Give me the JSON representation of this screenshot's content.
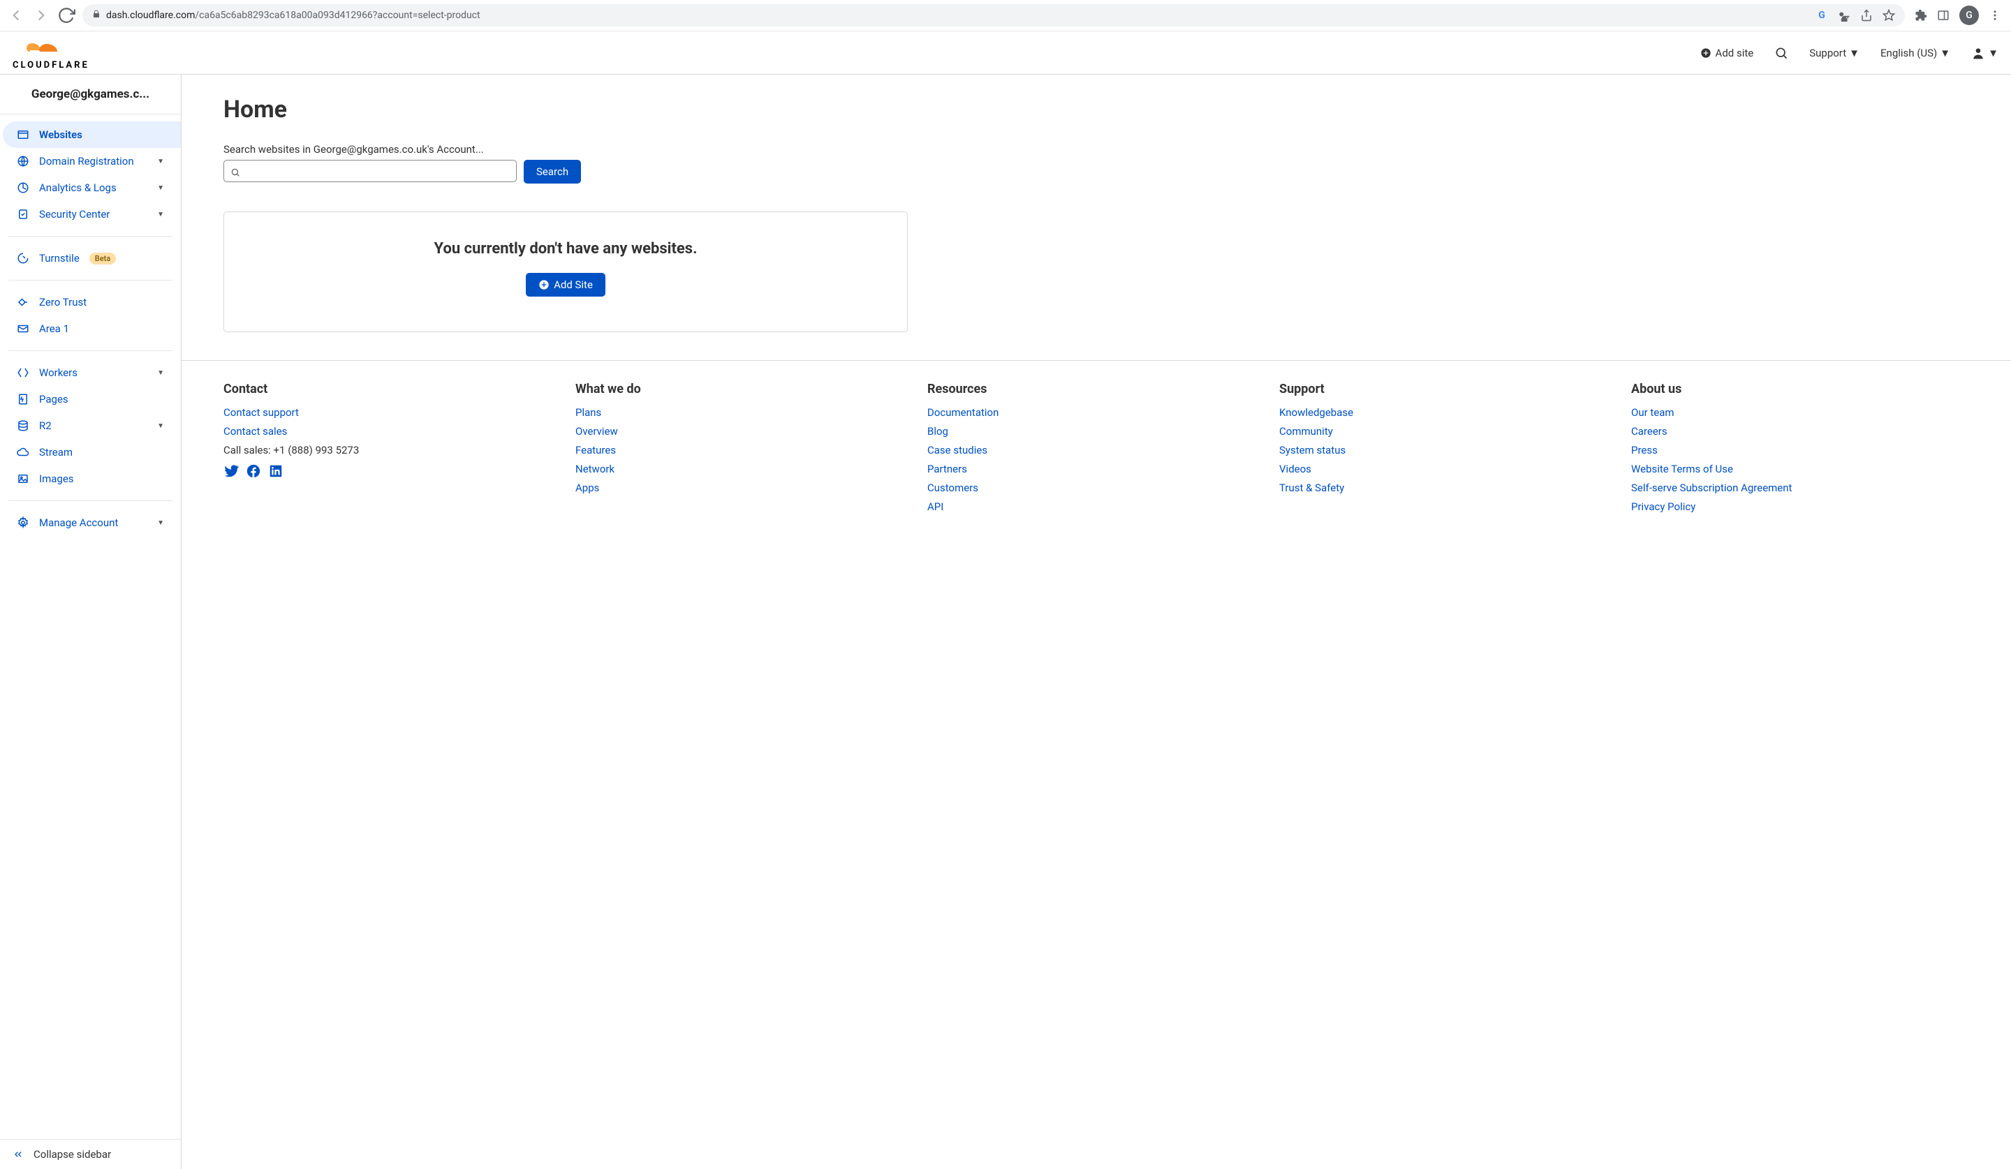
{
  "browser": {
    "url_host": "dash.cloudflare.com",
    "url_path": "/ca6a5c6ab8293ca618a00a093d412966?account=select-product",
    "avatar_letter": "G"
  },
  "header": {
    "add_site": "Add site",
    "support": "Support",
    "language": "English (US)"
  },
  "logo_text": "CLOUDFLARE",
  "sidebar": {
    "account": "George@gkgames.c...",
    "items": {
      "websites": "Websites",
      "domain": "Domain Registration",
      "analytics": "Analytics & Logs",
      "security": "Security Center",
      "turnstile": "Turnstile",
      "turnstile_badge": "Beta",
      "zero_trust": "Zero Trust",
      "area1": "Area 1",
      "workers": "Workers",
      "pages": "Pages",
      "r2": "R2",
      "stream": "Stream",
      "images": "Images",
      "manage": "Manage Account"
    },
    "collapse": "Collapse sidebar"
  },
  "main": {
    "title": "Home",
    "search_label": "Search websites in George@gkgames.co.uk's Account...",
    "search_button": "Search",
    "empty_title": "You currently don't have any websites.",
    "add_site_button": "Add Site"
  },
  "footer": {
    "contact": {
      "heading": "Contact",
      "support": "Contact support",
      "sales": "Contact sales",
      "call": "Call sales: +1 (888) 993 5273"
    },
    "what": {
      "heading": "What we do",
      "plans": "Plans",
      "overview": "Overview",
      "features": "Features",
      "network": "Network",
      "apps": "Apps"
    },
    "resources": {
      "heading": "Resources",
      "docs": "Documentation",
      "blog": "Blog",
      "case": "Case studies",
      "partners": "Partners",
      "customers": "Customers",
      "api": "API"
    },
    "support": {
      "heading": "Support",
      "kb": "Knowledgebase",
      "community": "Community",
      "status": "System status",
      "videos": "Videos",
      "trust": "Trust & Safety"
    },
    "about": {
      "heading": "About us",
      "team": "Our team",
      "careers": "Careers",
      "press": "Press",
      "terms": "Website Terms of Use",
      "selfserve": "Self-serve Subscription Agreement",
      "privacy": "Privacy Policy"
    }
  }
}
